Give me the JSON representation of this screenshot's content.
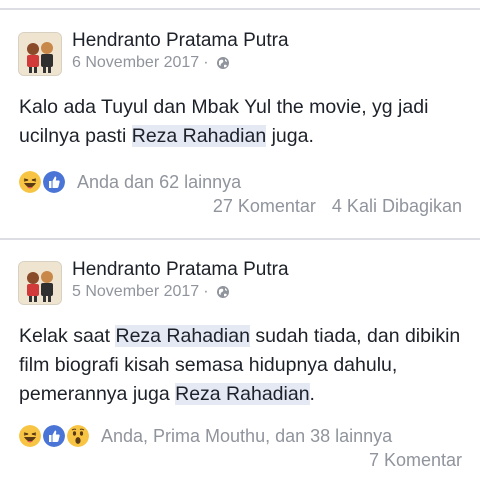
{
  "posts": [
    {
      "author": "Hendranto Pratama Putra",
      "date": "6 November 2017",
      "dot": "·",
      "text_a": "Kalo ada Tuyul dan Mbak Yul the movie, yg jadi ucilnya pasti ",
      "highlight_1": "Reza Rahadian",
      "text_b": " juga.",
      "reactions": [
        "haha-icon",
        "like-icon"
      ],
      "reaction_names": "Anda dan 62 lainnya",
      "comments": "27 Komentar",
      "shares": "4 Kali Dibagikan"
    },
    {
      "author": "Hendranto Pratama Putra",
      "date": "5 November 2017",
      "dot": "·",
      "text_a": "Kelak saat ",
      "highlight_1": "Reza Rahadian",
      "text_b": " sudah tiada, dan dibikin film biografi kisah semasa hidupnya dahulu, pemerannya juga ",
      "highlight_2": "Reza Rahadian",
      "text_c": ".",
      "reactions": [
        "haha-icon",
        "like-icon",
        "wow-icon"
      ],
      "reaction_names": "Anda, Prima Mouthu, dan 38 lainnya",
      "comments": "7 Komentar"
    }
  ],
  "colors": {
    "like": "#4a75d6",
    "reaction_yellow": "#f7c543",
    "muted_text": "#90949c",
    "highlight_bg": "#e4e9f4"
  }
}
